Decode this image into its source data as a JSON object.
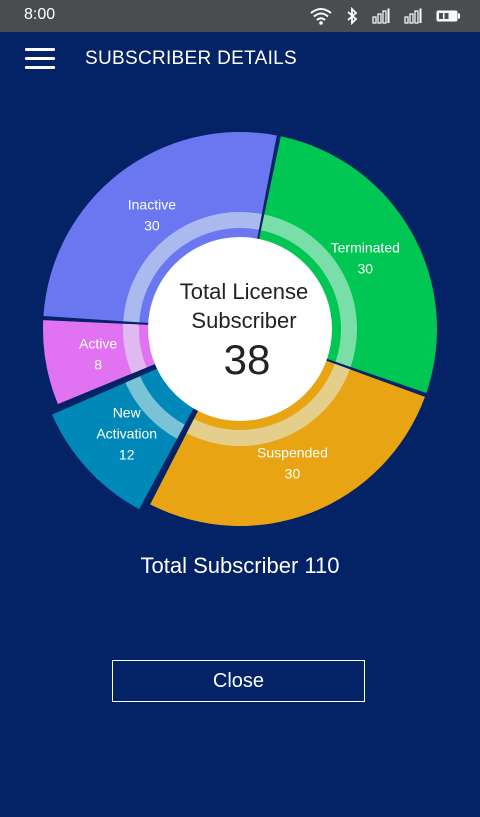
{
  "status_bar": {
    "time": "8:00",
    "icons": [
      "wifi-icon",
      "bluetooth-icon",
      "signal-icon",
      "signal-icon",
      "battery-icon"
    ]
  },
  "header": {
    "menu_icon": "hamburger-menu-icon",
    "title": "SUBSCRIBER DETAILS"
  },
  "center": {
    "line1": "Total License",
    "line2": "Subscriber",
    "value": "38"
  },
  "total": {
    "label": "Total Subscriber 110"
  },
  "close_button": {
    "label": "Close"
  },
  "chart_data": {
    "type": "pie",
    "slices": [
      {
        "label_lines": [
          "Active"
        ],
        "value": 8,
        "color": "#e173f2"
      },
      {
        "label_lines": [
          "Inactive"
        ],
        "value": 30,
        "color": "#6b77f0"
      },
      {
        "label_lines": [
          "Terminated"
        ],
        "value": 30,
        "color": "#00c653"
      },
      {
        "label_lines": [
          "Suspended"
        ],
        "value": 30,
        "color": "#e8a413"
      },
      {
        "label_lines": [
          "New",
          "Activation"
        ],
        "value": 12,
        "color": "#0089b8",
        "exploded": true
      }
    ],
    "center_ring_color": "#dff2ee",
    "total": 110
  }
}
